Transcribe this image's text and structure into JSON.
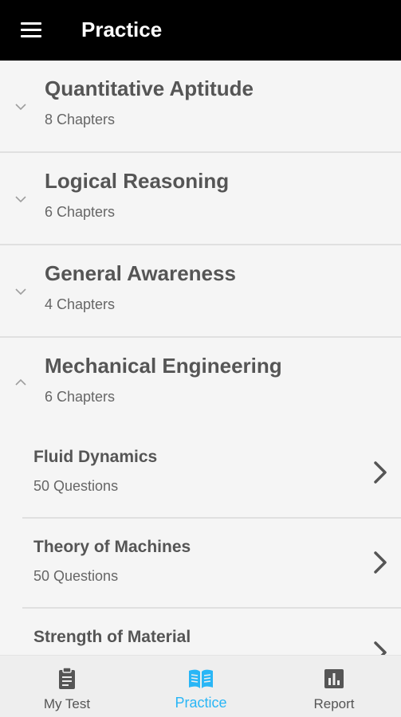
{
  "app_bar": {
    "title": "Practice",
    "menu_icon": "menu-icon"
  },
  "categories": [
    {
      "title": "Quantitative Aptitude",
      "subtitle": "8 Chapters",
      "state": "collapsed"
    },
    {
      "title": "Logical Reasoning",
      "subtitle": "6 Chapters",
      "state": "collapsed"
    },
    {
      "title": "General Awareness",
      "subtitle": "4 Chapters",
      "state": "collapsed"
    },
    {
      "title": "Mechanical Engineering",
      "subtitle": "6 Chapters",
      "state": "expanded"
    }
  ],
  "chapters": [
    {
      "title": "Fluid Dynamics",
      "subtitle": "50 Questions"
    },
    {
      "title": "Theory of Machines",
      "subtitle": "50 Questions"
    },
    {
      "title": "Strength of Material",
      "subtitle": ""
    }
  ],
  "bottom_nav": {
    "items": [
      {
        "label": "My Test",
        "icon": "clipboard-icon"
      },
      {
        "label": "Practice",
        "icon": "book-icon",
        "active": true
      },
      {
        "label": "Report",
        "icon": "bar-chart-icon"
      }
    ]
  },
  "colors": {
    "app_bar": "#000000",
    "accent": "#29b6f6",
    "background": "#f5f5f5"
  }
}
